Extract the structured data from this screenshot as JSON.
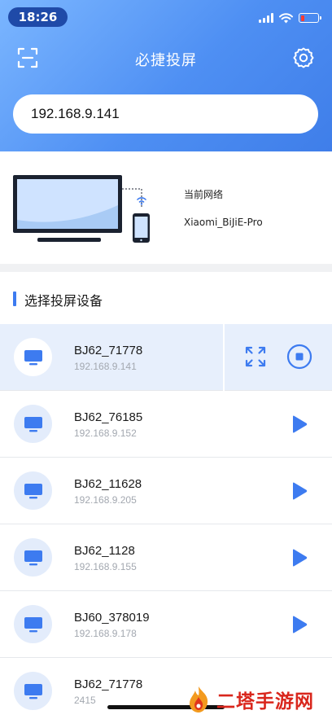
{
  "status_bar": {
    "time": "18:26",
    "battery_level": 0.2
  },
  "nav": {
    "title": "必捷投屏",
    "left_icon": "scan-icon",
    "right_icon": "settings-icon"
  },
  "ip_input": {
    "value": "192.168.9.141"
  },
  "network": {
    "label": "当前网络",
    "name": "Xiaomi_BiJiE-Pro"
  },
  "section": {
    "title": "选择投屏设备"
  },
  "devices": [
    {
      "name": "BJ62_71778",
      "ip": "192.168.9.141",
      "state": "active"
    },
    {
      "name": "BJ62_76185",
      "ip": "192.168.9.152",
      "state": "idle"
    },
    {
      "name": "BJ62_11628",
      "ip": "192.168.9.205",
      "state": "idle"
    },
    {
      "name": "BJ62_1128",
      "ip": "192.168.9.155",
      "state": "idle"
    },
    {
      "name": "BJ60_378019",
      "ip": "192.168.9.178",
      "state": "idle"
    },
    {
      "name": "BJ62_71778",
      "ip": "2415",
      "state": "idle"
    }
  ],
  "watermark": {
    "text": "二塔手游网"
  },
  "colors": {
    "accent": "#3d7bf0",
    "header_top": "#7bb6ff",
    "header_bottom": "#3f7ee9",
    "active_row": "#e7effc",
    "watermark": "#d9261c"
  }
}
